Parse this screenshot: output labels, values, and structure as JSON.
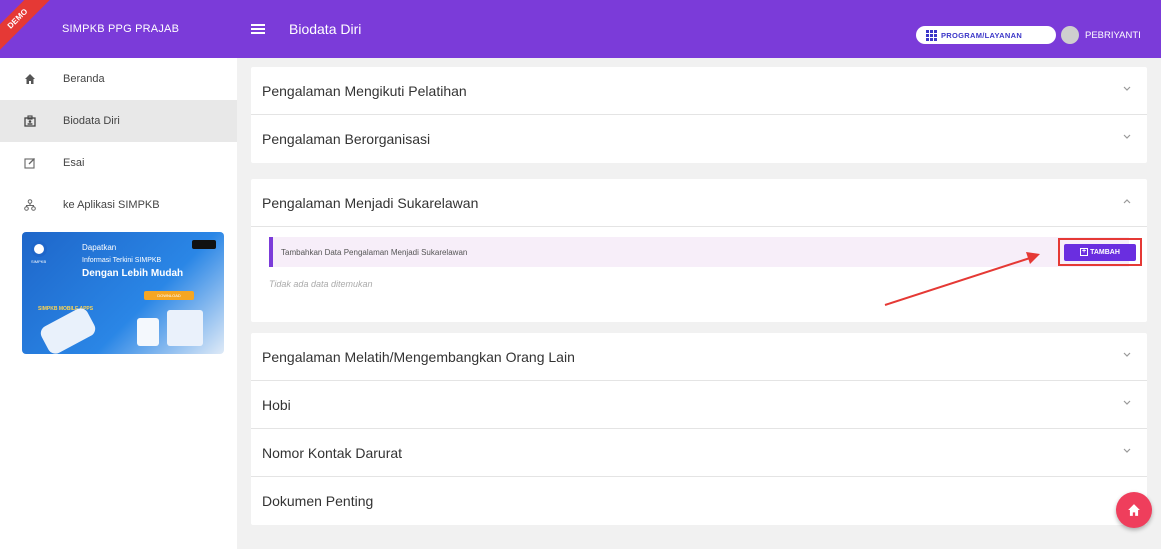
{
  "app": {
    "brand": "SIMPKB PPG PRAJAB",
    "demo_ribbon": "DEMO"
  },
  "sidebar": {
    "items": [
      {
        "label": "Beranda",
        "icon": "home-icon",
        "active": false
      },
      {
        "label": "Biodata Diri",
        "icon": "id-card-icon",
        "active": true
      },
      {
        "label": "Esai",
        "icon": "edit-icon",
        "active": false
      },
      {
        "label": "ke Aplikasi SIMPKB",
        "icon": "network-icon",
        "active": false
      }
    ],
    "banner": {
      "line1": "Dapatkan",
      "line2": "Informasi Terkini SIMPKB",
      "line3": "Dengan Lebih Mudah",
      "download": "DOWNLOAD",
      "mobile_label": "SIMPKB MOBILE APPS",
      "logo_label": "SIMPKB"
    }
  },
  "header": {
    "title": "Biodata Diri",
    "program_button": "PROGRAM/LAYANAN",
    "user_name": "PEBRIYANTI"
  },
  "sections": {
    "pelatihan": "Pengalaman Mengikuti Pelatihan",
    "organisasi": "Pengalaman Berorganisasi",
    "sukarelawan": "Pengalaman Menjadi Sukarelawan",
    "melatih": "Pengalaman Melatih/Mengembangkan Orang Lain",
    "hobi": "Hobi",
    "kontak": "Nomor Kontak Darurat",
    "dokumen": "Dokumen Penting"
  },
  "sukarelawan_panel": {
    "info_text": "Tambahkan Data Pengalaman Menjadi Sukarelawan",
    "add_button": "TAMBAH",
    "empty_text": "Tidak ada data ditemukan"
  },
  "colors": {
    "primary": "#7b3bd9",
    "button": "#6a2ee0",
    "highlight": "#e53935",
    "fab": "#ef3e5c"
  }
}
